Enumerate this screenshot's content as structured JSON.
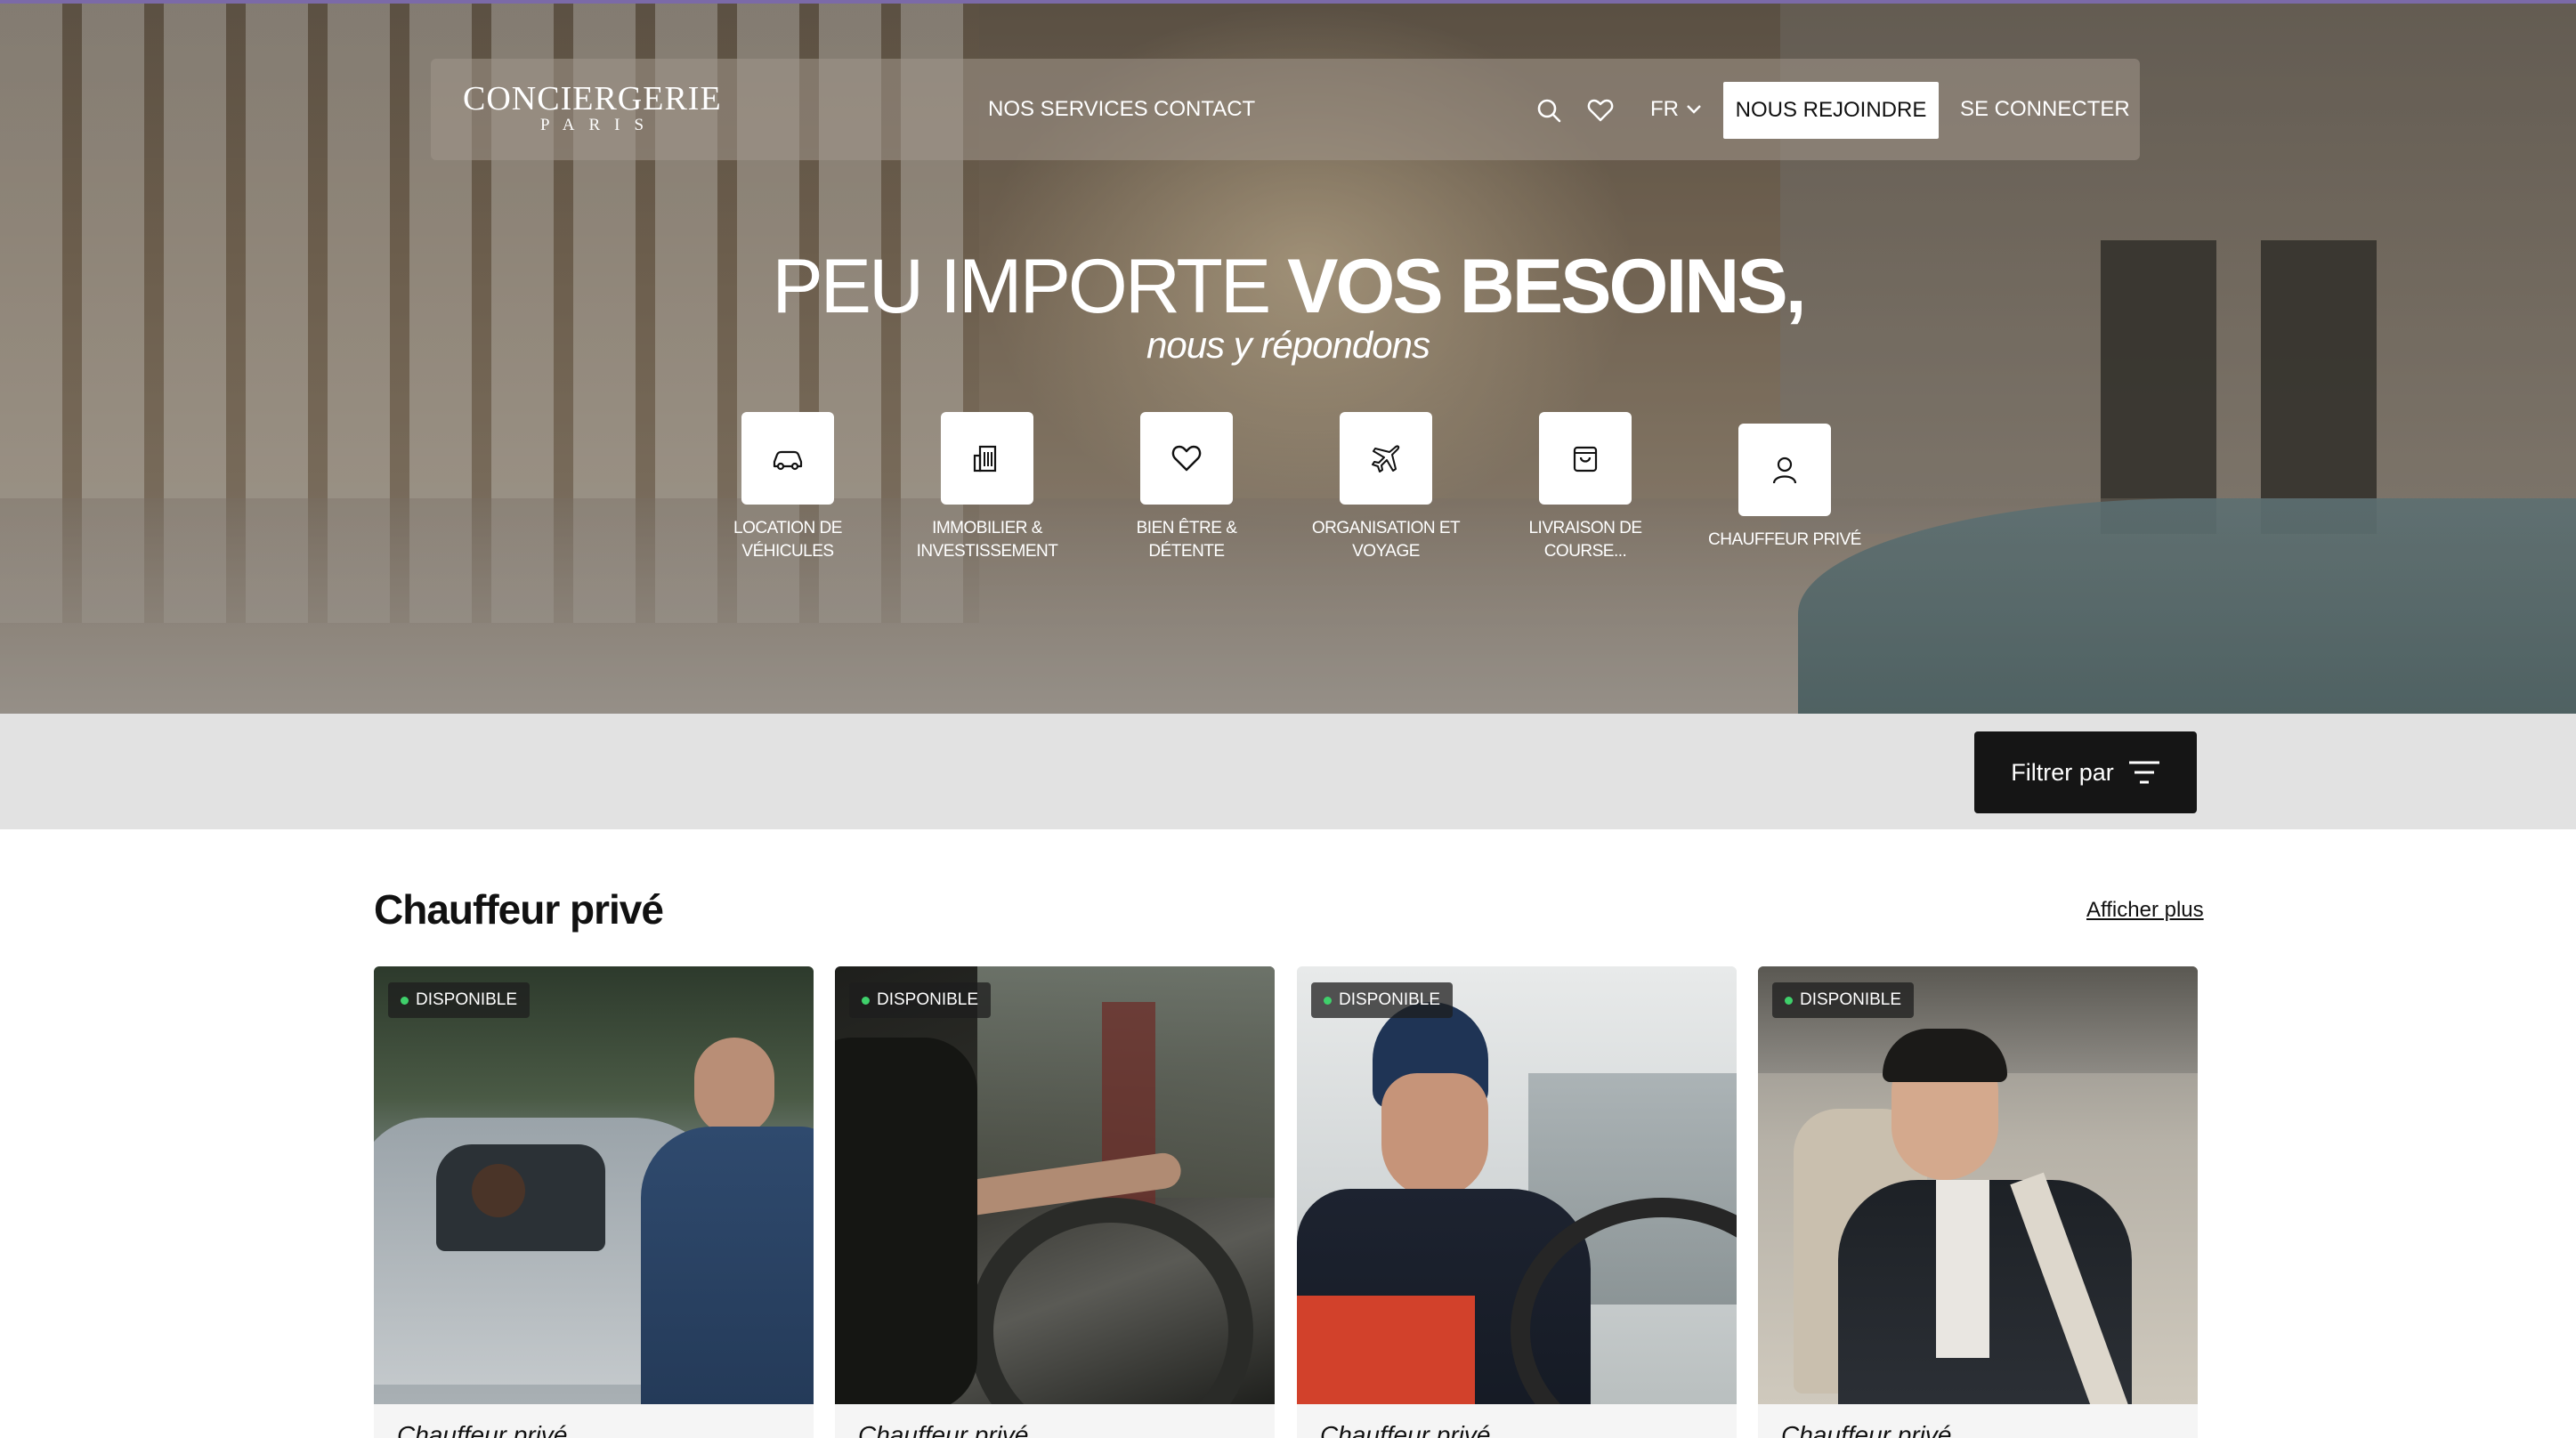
{
  "brand": {
    "name": "CONCIERGERIE",
    "city": "PARIS"
  },
  "nav": {
    "services": "NOS SERVICES",
    "contact": "CONTACT",
    "language": "FR",
    "join": "NOUS REJOINDRE",
    "login": "SE CONNECTER"
  },
  "hero": {
    "headline_light": "PEU IMPORTE ",
    "headline_bold": "VOS BESOINS,",
    "subline": "nous y répondons"
  },
  "categories": [
    {
      "icon": "car-icon",
      "line1": "LOCATION DE",
      "line2": "VÉHICULES"
    },
    {
      "icon": "building-icon",
      "line1": "IMMOBILIER &",
      "line2": "INVESTISSEMENT"
    },
    {
      "icon": "heart-icon",
      "line1": "BIEN ÊTRE &",
      "line2": "DÉTENTE"
    },
    {
      "icon": "plane-icon",
      "line1": "ORGANISATION ET",
      "line2": "VOYAGE"
    },
    {
      "icon": "shopping-bag-icon",
      "line1": "LIVRAISON DE",
      "line2": "COURSE..."
    },
    {
      "icon": "user-icon",
      "line1": "CHAUFFEUR PRIVÉ",
      "line2": ""
    }
  ],
  "filter": {
    "label": "Filtrer par"
  },
  "section": {
    "title": "Chauffeur privé",
    "more": "Afficher plus",
    "cards": [
      {
        "badge": "DISPONIBLE",
        "title": "Chauffeur privé"
      },
      {
        "badge": "DISPONIBLE",
        "title": "Chauffeur privé"
      },
      {
        "badge": "DISPONIBLE",
        "title": "Chauffeur privé"
      },
      {
        "badge": "DISPONIBLE",
        "title": "Chauffeur privé"
      }
    ]
  },
  "colors": {
    "badge_dot": "#3fd06b",
    "filter_button": "#151515",
    "filter_bar": "#e2e2e2"
  }
}
